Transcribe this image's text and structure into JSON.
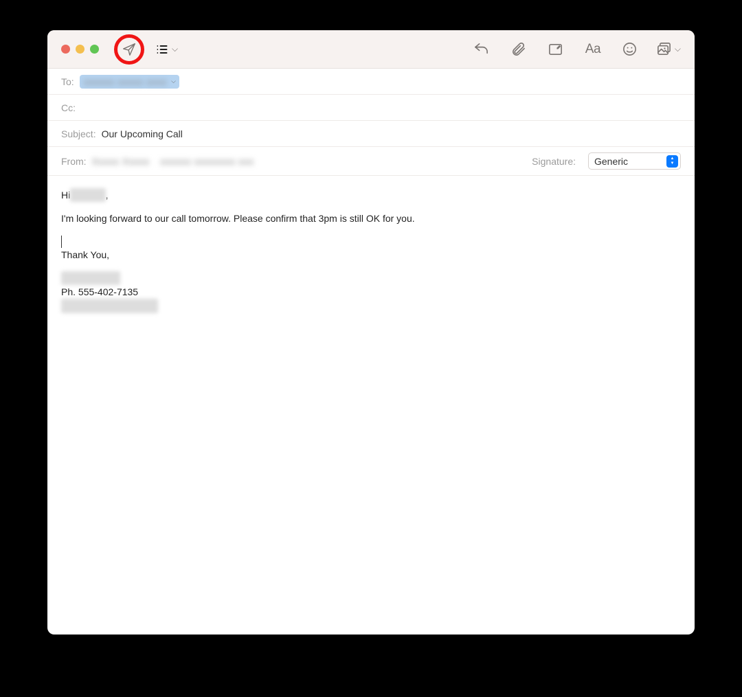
{
  "fields": {
    "to_label": "To:",
    "cc_label": "Cc:",
    "subject_label": "Subject:",
    "subject_value": "Our Upcoming Call",
    "from_label": "From:",
    "signature_label": "Signature:",
    "signature_value": "Generic"
  },
  "body": {
    "greeting_prefix": "Hi ",
    "greeting_suffix": ",",
    "paragraph1": "I'm looking forward to our call tomorrow. Please confirm that 3pm is still OK for you.",
    "thank_you": "Thank You,",
    "phone_line": "Ph. 555-402-7135"
  }
}
